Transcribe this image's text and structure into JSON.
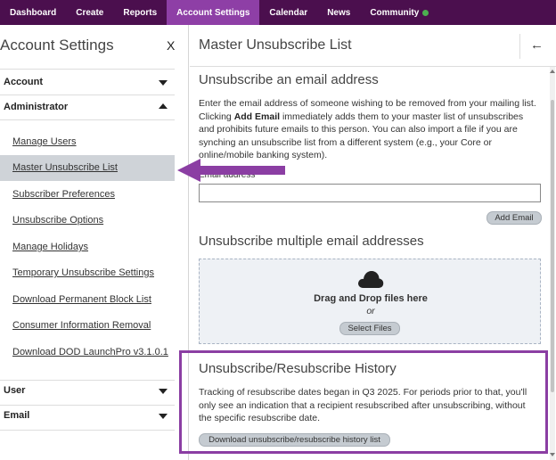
{
  "topnav": {
    "items": [
      "Dashboard",
      "Create",
      "Reports",
      "Account Settings",
      "Calendar",
      "News",
      "Community"
    ],
    "active_index": 3
  },
  "sidebar": {
    "title": "Account Settings",
    "close": "X",
    "sections": {
      "account": "Account",
      "administrator": "Administrator",
      "user": "User",
      "email": "Email"
    },
    "links": [
      "Manage Users",
      "Master Unsubscribe List",
      "Subscriber Preferences",
      "Unsubscribe Options",
      "Manage Holidays",
      "Temporary Unsubscribe Settings",
      "Download Permanent Block List",
      "Consumer Information Removal",
      "Download DOD LaunchPro v3.1.0.1"
    ],
    "active_link_index": 1
  },
  "main": {
    "header": "Master Unsubscribe List",
    "back_icon": "arrow-left-icon",
    "single": {
      "title": "Unsubscribe an email address",
      "para_1": "Enter the email address of someone wishing to be removed from your mailing list. Clicking ",
      "para_bold": "Add Email",
      "para_2": " immediately adds them to your master list of unsubscribes and prohibits future emails to this person. You can also import a file if you are synching an unsubscribe list from a different system (e.g., your Core or online/mobile banking system).",
      "field_label": "Email address",
      "input_value": "",
      "add_button": "Add Email"
    },
    "multiple": {
      "title": "Unsubscribe multiple email addresses",
      "drop_title": "Drag and Drop files here",
      "or": "or",
      "select_button": "Select Files"
    },
    "history": {
      "title": "Unsubscribe/Resubscribe History",
      "text": "Tracking of resubscribe dates began in Q3 2025. For periods prior to that, you'll only see an indication that a recipient resubscribed after unsubscribing, without the specific resubscribe date.",
      "download_button": "Download unsubscribe/resubscribe history list"
    }
  },
  "colors": {
    "nav_bg": "#4b0f4e",
    "nav_active": "#8e3fa6",
    "annotation": "#8b3ea3",
    "status_dot": "#4caf50"
  }
}
